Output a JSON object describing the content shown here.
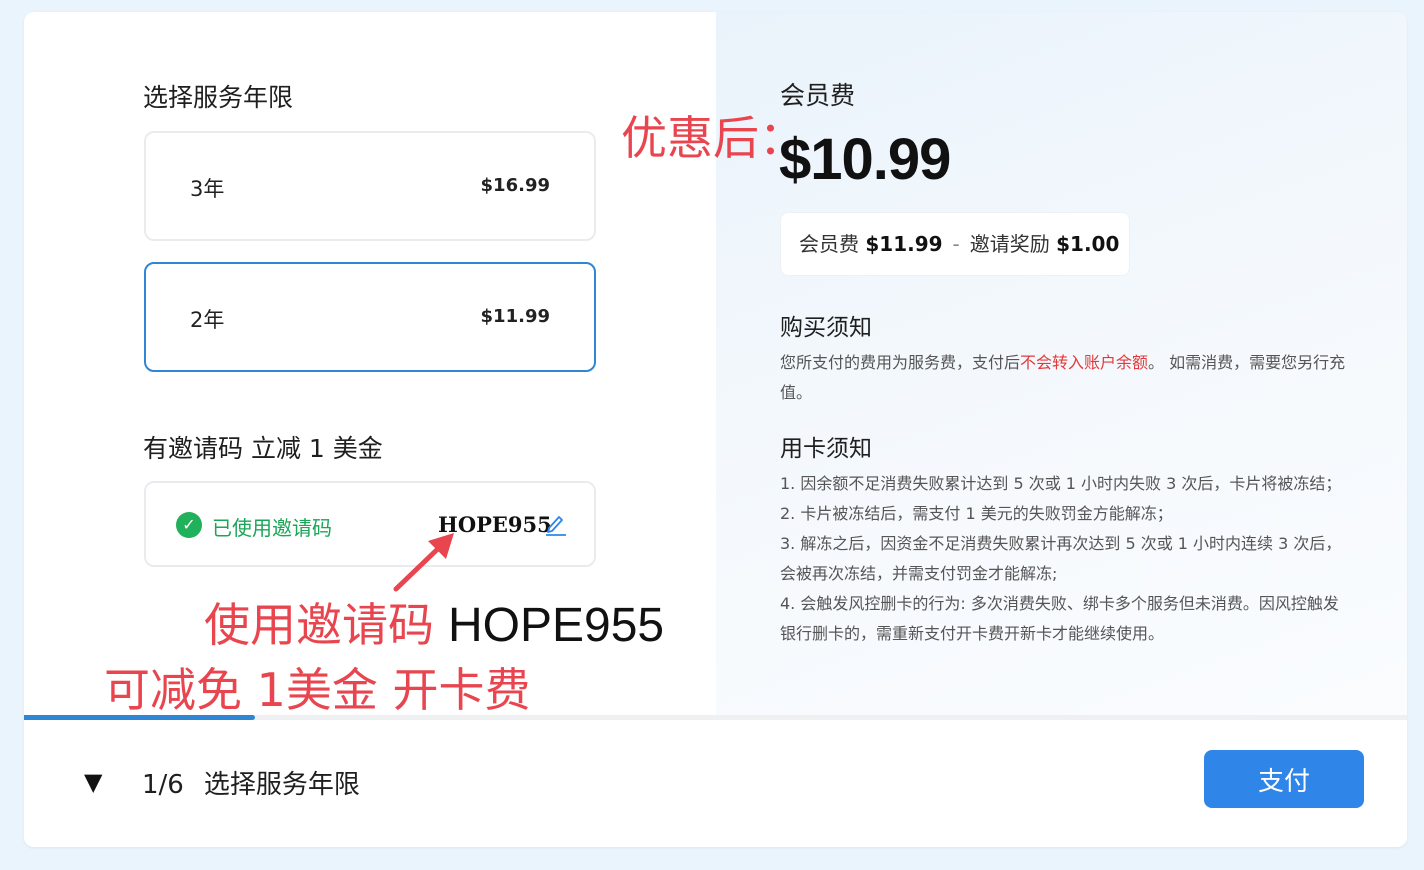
{
  "left": {
    "duration_title": "选择服务年限",
    "options": [
      {
        "label": "3年",
        "price": "$16.99",
        "selected": false
      },
      {
        "label": "2年",
        "price": "$11.99",
        "selected": true
      }
    ],
    "invite_title": "有邀请码 立减 1 美金",
    "invite_status": "已使用邀请码",
    "invite_code": "HOPE955"
  },
  "right": {
    "fee_label": "会员费",
    "final_price": "$10.99",
    "breakdown": {
      "fee_label": "会员费",
      "fee_amount": "$11.99",
      "separator": "-",
      "reward_label": "邀请奖励",
      "reward_amount": "$1.00"
    },
    "purchase_notice_title": "购买须知",
    "purchase_notice_text_1": "您所支付的费用为服务费，支付后",
    "purchase_notice_text_red": "不会转入账户余额",
    "purchase_notice_text_2": "。 如需消费，需要您另行充值。",
    "card_notice_title": "用卡须知",
    "card_notice_items": [
      "1. 因余额不足消费失败累计达到 5 次或 1 小时内失败 3 次后，卡片将被冻结；",
      "2. 卡片被冻结后，需支付 1 美元的失败罚金方能解冻；",
      "3. 解冻之后，因资金不足消费失败累计再次达到 5 次或 1 小时内连续 3 次后，会被再次冻结，并需支付罚金才能解冻;",
      "4. 会触发风控删卡的行为: 多次消费失败、绑卡多个服务但未消费。因风控触发银行删卡的，需重新支付开卡费开新卡才能继续使用。"
    ]
  },
  "annotations": {
    "after_discount": "优惠后：",
    "use_code_prefix": "使用邀请码",
    "use_code_value": "HOPE955",
    "save_text": "可减免 1美金 开卡费"
  },
  "footer": {
    "toggle_icon": "▼",
    "step_counter": "1/6",
    "step_title": "选择服务年限",
    "pay_label": "支付"
  },
  "progress": {
    "current_step": 1,
    "total_steps": 6
  },
  "colors": {
    "accent": "#2f86e8",
    "success": "#1aa656",
    "annotation": "#e8454f",
    "warning_text": "#e23a3a"
  }
}
